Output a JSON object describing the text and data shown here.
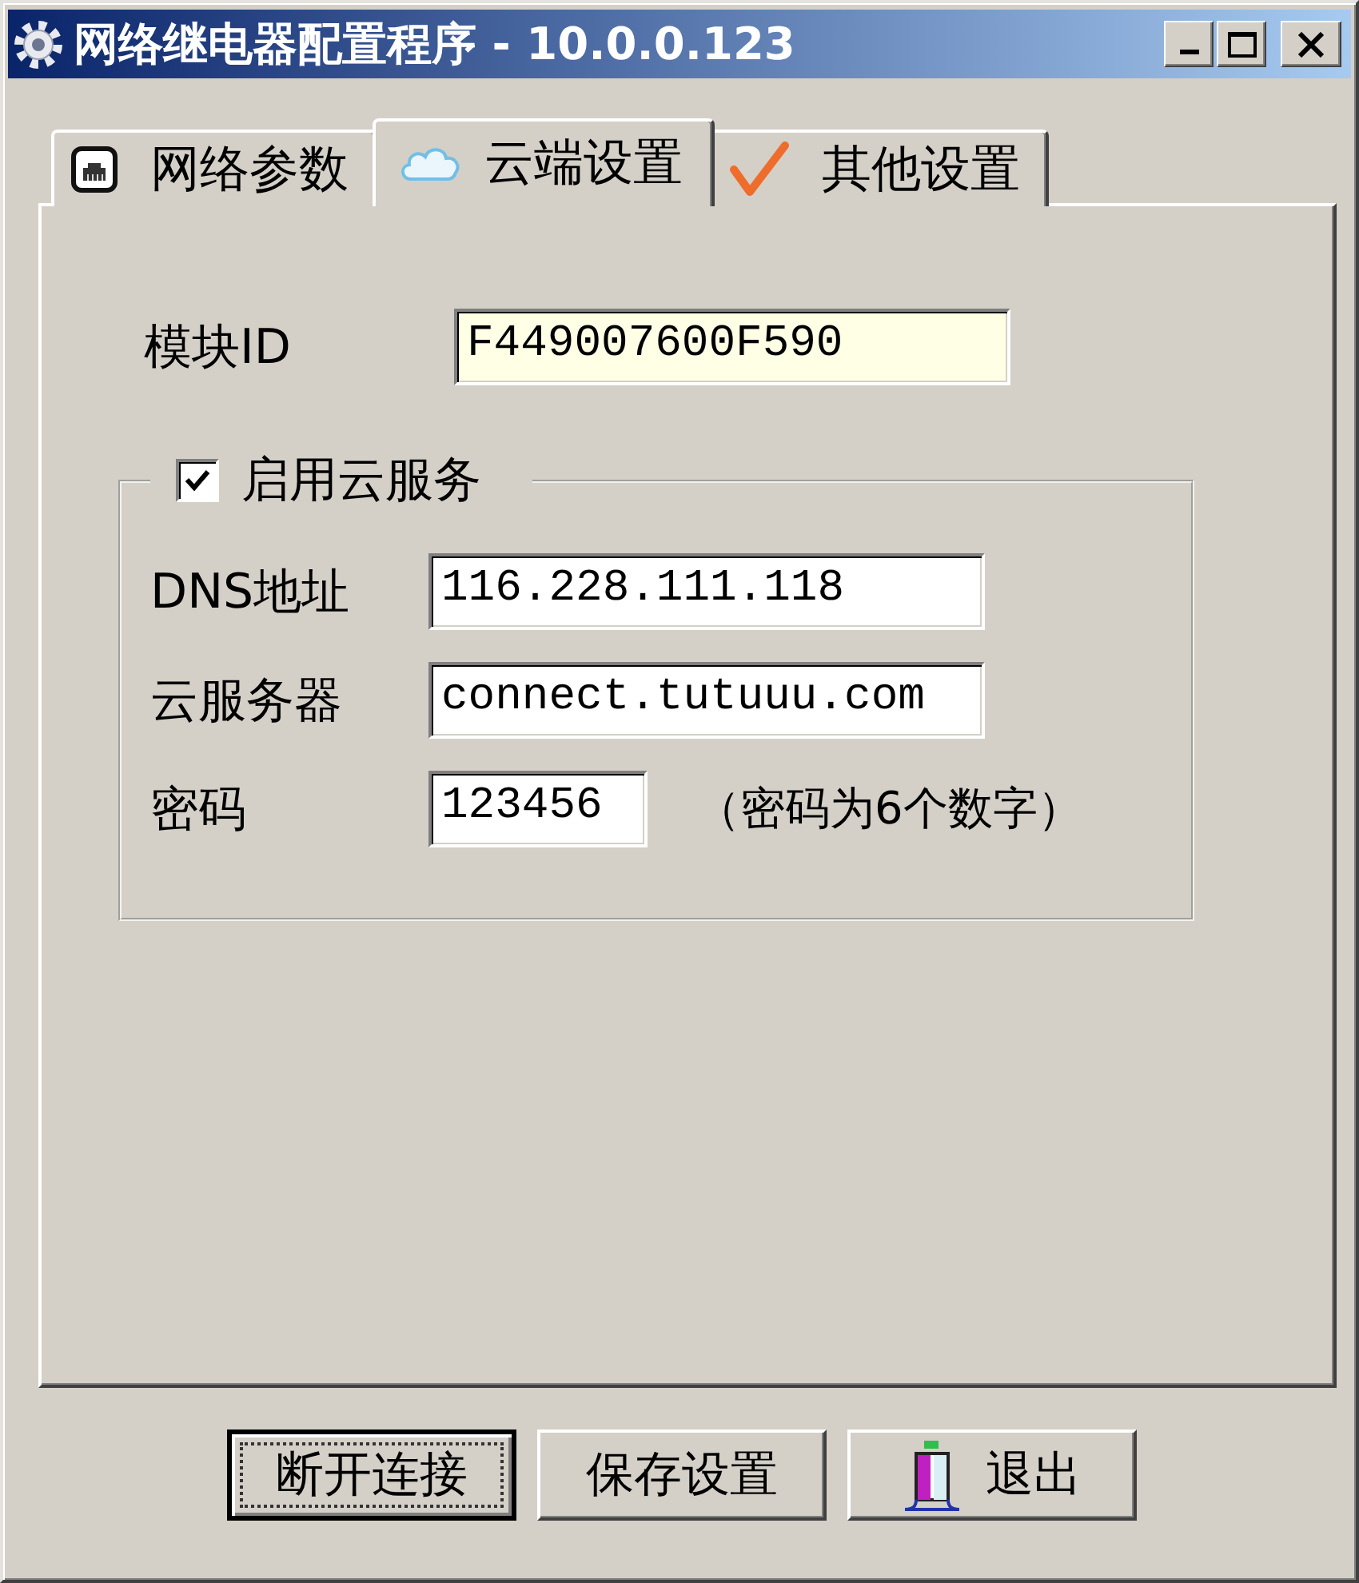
{
  "window": {
    "title": "网络继电器配置程序 - 10.0.0.123"
  },
  "tabs": [
    {
      "label": "网络参数",
      "selected": false
    },
    {
      "label": "云端设置",
      "selected": true
    },
    {
      "label": "其他设置",
      "selected": false
    }
  ],
  "module": {
    "label": "模块ID",
    "value": "F449007600F590",
    "readonly": true
  },
  "cloud": {
    "enable": {
      "label": "启用云服务",
      "checked": true
    },
    "fields": [
      {
        "label": "DNS地址",
        "value": "116.228.111.118"
      },
      {
        "label": "云服务器",
        "value": "connect.tutuuu.com"
      },
      {
        "label": "密码",
        "value": "123456",
        "note": "（密码为6个数字）"
      }
    ]
  },
  "buttons": [
    {
      "label": "断开连接",
      "focused": true
    },
    {
      "label": "保存设置",
      "focused": false
    },
    {
      "label": "退出",
      "focused": false
    }
  ]
}
